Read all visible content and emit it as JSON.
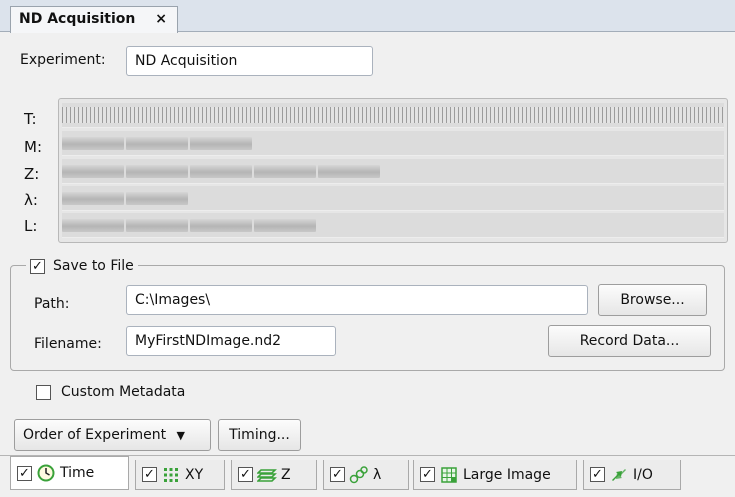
{
  "document_tab": {
    "title": "ND Acquisition",
    "close_glyph": "×"
  },
  "experiment": {
    "label": "Experiment:",
    "value": "ND Acquisition"
  },
  "dimension_rows": [
    {
      "label": "T:",
      "segments": "dense"
    },
    {
      "label": "M:",
      "segments": 3
    },
    {
      "label": "Z:",
      "segments": 5
    },
    {
      "label": "λ:",
      "segments": 2
    },
    {
      "label": "L:",
      "segments": 4
    }
  ],
  "save_to_file": {
    "label": "Save to File",
    "checked": true,
    "path": {
      "label": "Path:",
      "value": "C:\\Images\\"
    },
    "filename": {
      "label": "Filename:",
      "value": "MyFirstNDImage.nd2"
    },
    "browse_label": "Browse...",
    "record_label": "Record Data..."
  },
  "custom_metadata": {
    "label": "Custom Metadata",
    "checked": false
  },
  "buttons": {
    "order_label": "Order of Experiment",
    "timing_label": "Timing..."
  },
  "tabs": [
    {
      "label": "Time",
      "icon": "clock-icon",
      "checked": true,
      "active": true
    },
    {
      "label": "XY",
      "icon": "xy-grid-icon",
      "checked": true
    },
    {
      "label": "Z",
      "icon": "z-stack-icon",
      "checked": true
    },
    {
      "label": "λ",
      "icon": "lambda-circles-icon",
      "checked": true
    },
    {
      "label": "Large Image",
      "icon": "large-image-icon",
      "checked": true
    },
    {
      "label": "I/O",
      "icon": "io-arrows-icon",
      "checked": true
    }
  ],
  "colors": {
    "accent_green": "#3aa23a",
    "tab_strip": "#dce3ec"
  }
}
